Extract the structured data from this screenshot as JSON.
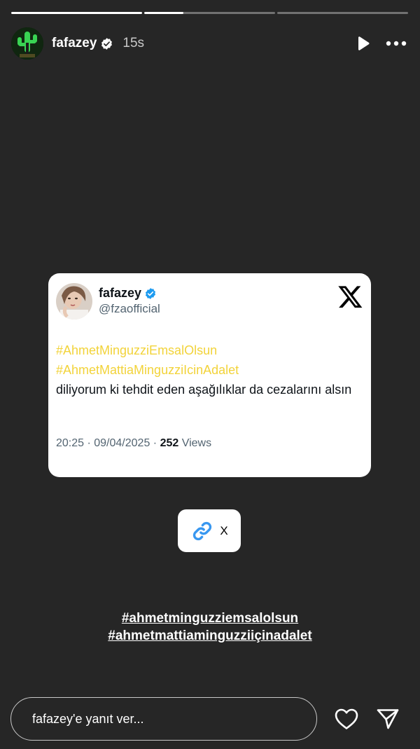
{
  "progress": {
    "segments": [
      {
        "fill": 1.0
      },
      {
        "fill": 0.3
      },
      {
        "fill": 0.0
      }
    ]
  },
  "header": {
    "username": "fafazey",
    "time_ago": "15s",
    "avatar_icon": "cactus-neon-avatar",
    "verified_icon": "verified-badge-icon",
    "play_icon": "play-icon",
    "more_icon": "more-dots-icon"
  },
  "tweet": {
    "name": "fafazey",
    "handle": "@fzaofficial",
    "hashtags": [
      "#AhmetMinguzziEmsalOlsun",
      "#AhmetMattiaMinguzziIcinAdalet"
    ],
    "text": "diliyorum ki tehdit eden aşağılıklar da cezalarını alsın",
    "time_date": "20:25 · 09/04/2025 · ",
    "views_count": "252",
    "views_label": " Views",
    "hashtag_color": "#f2d33a",
    "logo_icon": "x-logo-icon"
  },
  "link_sticker": {
    "label": "X",
    "icon": "link-icon",
    "icon_color": "#3897f0"
  },
  "story_tags": [
    "#ahmetminguzziemsalolsun",
    "#ahmetmattiaminguzziiçinadalet"
  ],
  "reply": {
    "placeholder": "fafazey'e yanıt ver...",
    "heart_icon": "heart-icon",
    "send_icon": "send-icon"
  }
}
